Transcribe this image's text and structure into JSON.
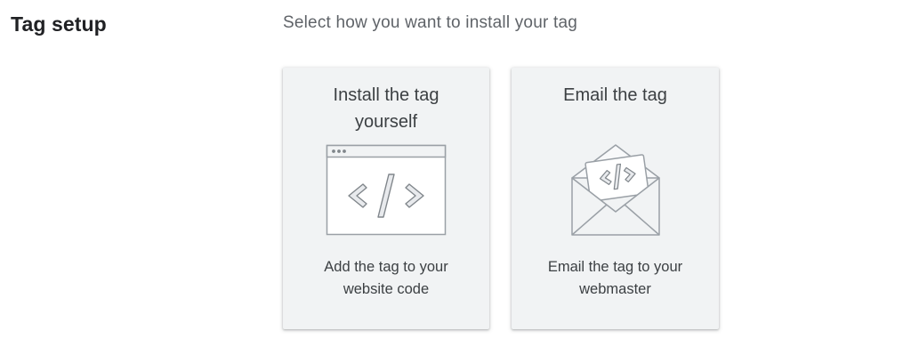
{
  "section": {
    "title": "Tag setup",
    "prompt": "Select how you want to install your tag"
  },
  "options": [
    {
      "title": "Install the tag yourself",
      "description": "Add the tag to your website code",
      "icon": "browser-code-icon"
    },
    {
      "title": "Email the tag",
      "description": "Email the tag to your webmaster",
      "icon": "envelope-code-icon"
    }
  ],
  "colors": {
    "card_background": "#f1f3f4",
    "heading_text": "#202124",
    "prompt_text": "#5f6368",
    "card_text": "#3c4043",
    "icon_stroke": "#9aa0a6"
  }
}
